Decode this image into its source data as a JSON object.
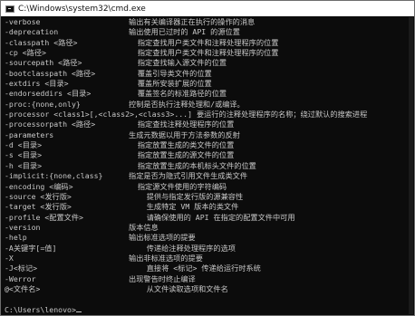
{
  "window": {
    "title": "C:\\Windows\\system32\\cmd.exe"
  },
  "console": {
    "lines": [
      {
        "opt": "-verbose",
        "desc": "输出有关编译器正在执行的操作的消息"
      },
      {
        "opt": "-deprecation",
        "desc": "输出使用已过时的 API 的源位置"
      },
      {
        "opt": "-classpath <路径>",
        "desc": "  指定查找用户类文件和注释处理程序的位置"
      },
      {
        "opt": "-cp <路径>",
        "desc": "  指定查找用户类文件和注释处理程序的位置"
      },
      {
        "opt": "-sourcepath <路径>",
        "desc": "  指定查找输入源文件的位置"
      },
      {
        "opt": "-bootclasspath <路径>",
        "desc": "  覆盖引导类文件的位置"
      },
      {
        "opt": "-extdirs <目录>",
        "desc": "  覆盖所安装扩展的位置"
      },
      {
        "opt": "-endorseddirs <目录>",
        "desc": "  覆盖签名的标准路径的位置"
      },
      {
        "opt": "-proc:{none,only}",
        "desc": "控制是否执行注释处理和/或编译。"
      },
      {
        "opt": "-processor <class1>[,<class2>,<class3>...] 要运行的注释处理程序的名称；绕过默认的搜索进程",
        "desc": ""
      },
      {
        "opt": "-processorpath <路径>",
        "desc": "  指定查找注释处理程序的位置"
      },
      {
        "opt": "-parameters",
        "desc": "生成元数据以用于方法参数的反射"
      },
      {
        "opt": "-d <目录>",
        "desc": "  指定放置生成的类文件的位置"
      },
      {
        "opt": "-s <目录>",
        "desc": "  指定放置生成的源文件的位置"
      },
      {
        "opt": "-h <目录>",
        "desc": "  指定放置生成的本机标头文件的位置"
      },
      {
        "opt": "-implicit:{none,class}",
        "desc": "指定是否为隐式引用文件生成类文件"
      },
      {
        "opt": "-encoding <编码>",
        "desc": "  指定源文件使用的字符编码"
      },
      {
        "opt": "-source <发行版>",
        "desc": "    提供与指定发行版的源兼容性"
      },
      {
        "opt": "-target <发行版>",
        "desc": "    生成特定 VM 版本的类文件"
      },
      {
        "opt": "-profile <配置文件>",
        "desc": "    请确保使用的 API 在指定的配置文件中可用"
      },
      {
        "opt": "-version",
        "desc": "版本信息"
      },
      {
        "opt": "-help",
        "desc": "输出标准选项的提要"
      },
      {
        "opt": "-A关键字[=值]",
        "desc": "    传递给注释处理程序的选项"
      },
      {
        "opt": "-X",
        "desc": "输出非标准选项的提要"
      },
      {
        "opt": "-J<标记>",
        "desc": "    直接将 <标记> 传递给运行时系统"
      },
      {
        "opt": "-Werror",
        "desc": "出现警告时终止编译"
      },
      {
        "opt": "@<文件名>",
        "desc": "    从文件读取选项和文件名"
      }
    ],
    "prompt": "C:\\Users\\lenovo>"
  }
}
